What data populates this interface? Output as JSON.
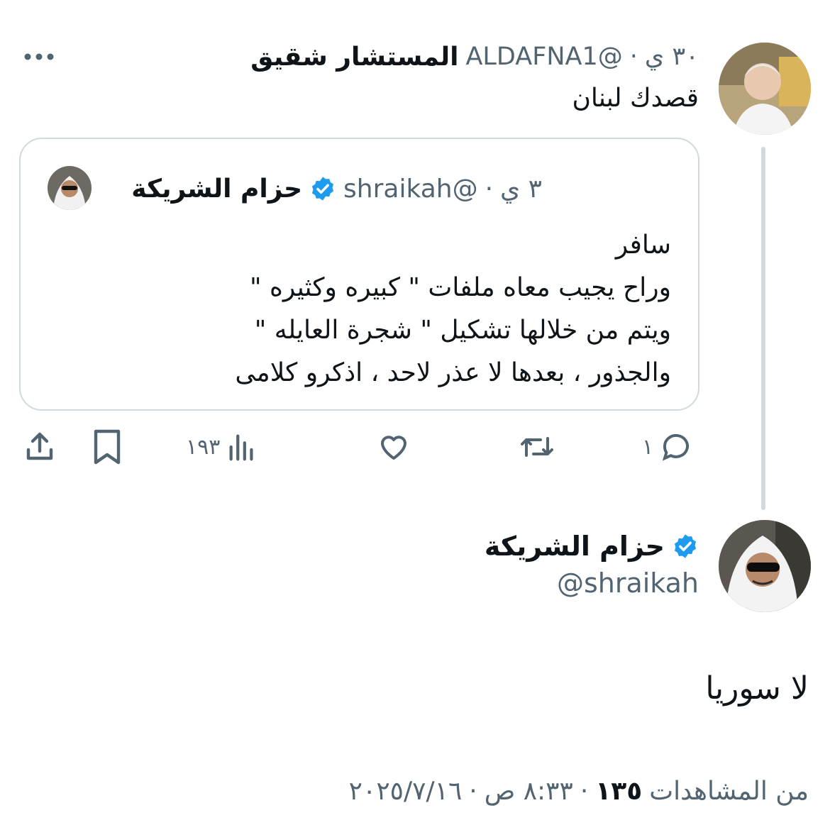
{
  "reply": {
    "name": "المستشار شقيق",
    "handle": "@ALDAFNA1",
    "separator": "·",
    "time": "٣٠ ي",
    "text": "قصدك لبنان",
    "more_icon": "more-horizontal-icon"
  },
  "quote": {
    "name": "حزام الشريكة",
    "handle": "@shraikah",
    "separator": "·",
    "time": "٣ ي",
    "verified_color": "#1d9bf0",
    "lines": [
      "سافر",
      "وراح يجيب معاه ملفات \" كبيره وكثيره \"",
      "ويتم من خلالها تشكيل \" شجرة العايله \"",
      "والجذور ، بعدها لا عذر لاحد ، اذكرو كلامى"
    ]
  },
  "actions": {
    "reply_count": "١",
    "views_count": "١٩٣",
    "icons": [
      "reply-icon",
      "retweet-icon",
      "like-icon",
      "views-icon",
      "bookmark-icon",
      "share-icon"
    ]
  },
  "main": {
    "name": "حزام الشريكة",
    "handle": "@shraikah",
    "text": "لا سوريا",
    "date": "٢٠٢٥/٧/١٦",
    "time": "٨:٣٣ ص",
    "separator": "·",
    "views": "١٣٥",
    "views_label": "من المشاهدات"
  },
  "colors": {
    "text": "#0f1419",
    "secondary": "#536471",
    "border": "#cfd9de",
    "verified": "#1d9bf0"
  }
}
